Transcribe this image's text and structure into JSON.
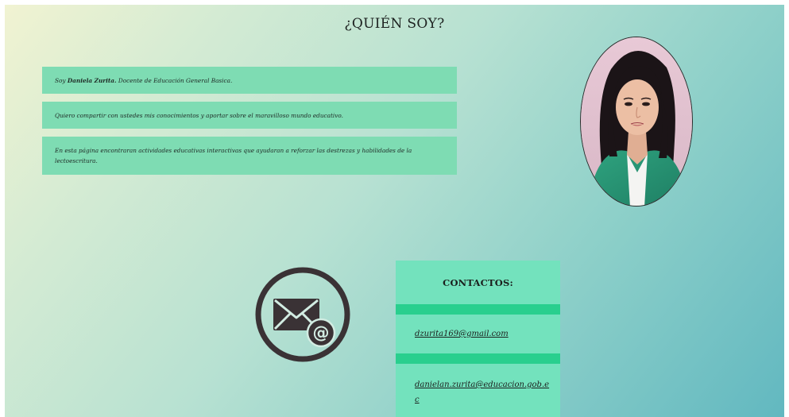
{
  "page": {
    "title": "¿QUIÉN SOY?"
  },
  "intro": {
    "line1_prefix": "Soy ",
    "line1_name": "Daniela Zurita.",
    "line1_suffix": " Docente de Educación General Basica.",
    "line2": "Quiero compartir con ustedes mis conocimientos y aportar sobre el maravilloso mundo educativo.",
    "line3": "En esta página encontraran actividades educativas interactivas que ayudaran a reforzar las destrezas y habilidades de la lectoescritura."
  },
  "contacts": {
    "title": "CONTACTOS:",
    "email1": "dzurita169@gmail.com",
    "email2": "danielan.zurita@educacion.gob.ec"
  },
  "icons": {
    "email": "envelope-at-icon",
    "portrait": "profile-photo"
  },
  "colors": {
    "box_fill": "#7edcb3",
    "panel_fill": "#73e2bd",
    "stripe": "#29cf8e",
    "icon_dark": "#3a3235"
  }
}
